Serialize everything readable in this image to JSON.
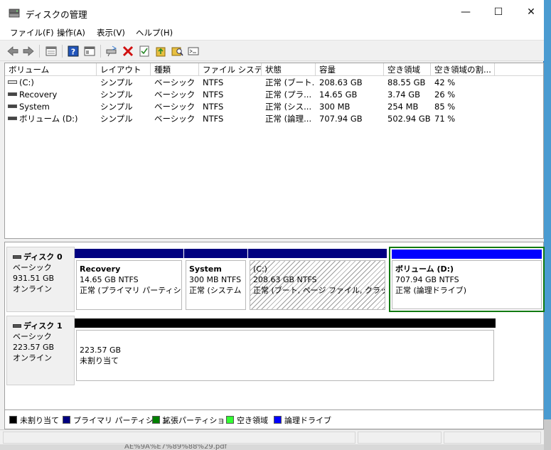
{
  "window": {
    "title": "ディスクの管理",
    "controls": {
      "minimize": "—",
      "maximize": "☐",
      "close": "✕"
    }
  },
  "menu": [
    {
      "label": "ファイル(F)"
    },
    {
      "label": "操作(A)"
    },
    {
      "label": "表示(V)"
    },
    {
      "label": "ヘルプ(H)"
    }
  ],
  "toolbar": {
    "icons": [
      "back-arrow-icon",
      "forward-arrow-icon",
      "disk-list-icon",
      "help-icon",
      "properties-icon",
      "connect-drive-icon",
      "delete-icon",
      "check-icon",
      "folder-up-icon",
      "search-folder-icon",
      "console-icon"
    ],
    "colors": {
      "delete": "#d01010",
      "help": "#2255bb",
      "folder": "#e8c040"
    }
  },
  "volumes": {
    "columns": [
      "ボリューム",
      "レイアウト",
      "種類",
      "ファイル システム",
      "状態",
      "容量",
      "空き領域",
      "空き領域の割..."
    ],
    "rows": [
      {
        "volume": "(C:)",
        "layout": "シンプル",
        "type": "ベーシック",
        "fs": "NTFS",
        "status": "正常 (ブート...",
        "capacity": "208.63 GB",
        "free": "88.55 GB",
        "pct": "42 %"
      },
      {
        "volume": "Recovery",
        "layout": "シンプル",
        "type": "ベーシック",
        "fs": "NTFS",
        "status": "正常 (プラ...",
        "capacity": "14.65 GB",
        "free": "3.74 GB",
        "pct": "26 %"
      },
      {
        "volume": "System",
        "layout": "シンプル",
        "type": "ベーシック",
        "fs": "NTFS",
        "status": "正常 (シス...",
        "capacity": "300 MB",
        "free": "254 MB",
        "pct": "85 %"
      },
      {
        "volume": "ボリューム (D:)",
        "layout": "シンプル",
        "type": "ベーシック",
        "fs": "NTFS",
        "status": "正常 (論理...",
        "capacity": "707.94 GB",
        "free": "502.94 GB",
        "pct": "71 %"
      }
    ]
  },
  "disks": [
    {
      "name": "ディスク 0",
      "type": "ベーシック",
      "size": "931.51 GB",
      "state": "オンライン",
      "partitions": [
        {
          "name": "Recovery",
          "size": "14.65 GB NTFS",
          "status": "正常 (プライマリ パーティション)"
        },
        {
          "name": "System",
          "size": "300 MB NTFS",
          "status": "正常 (システム"
        },
        {
          "name": "(C:)",
          "size": "208.63 GB NTFS",
          "status": "正常 (ブート, ページ ファイル, クラッシュ ダ"
        },
        {
          "name": "ボリューム  (D:)",
          "size": "707.94 GB NTFS",
          "status": "正常 (論理ドライブ)"
        }
      ]
    },
    {
      "name": "ディスク 1",
      "type": "ベーシック",
      "size": "223.57 GB",
      "state": "オンライン",
      "partitions": [
        {
          "name": "",
          "size": "223.57 GB",
          "status": "未割り当て"
        }
      ]
    }
  ],
  "legend": [
    {
      "label": "未割り当て",
      "color": "#000000"
    },
    {
      "label": "プライマリ パーティション",
      "color": "#000080"
    },
    {
      "label": "拡張パーティション",
      "color": "#008000"
    },
    {
      "label": "空き領域",
      "color": "#33ff33"
    },
    {
      "label": "論理ドライブ",
      "color": "#0000ff"
    }
  ],
  "background_text": "AE%9A%E7%89%88%29.pdf"
}
